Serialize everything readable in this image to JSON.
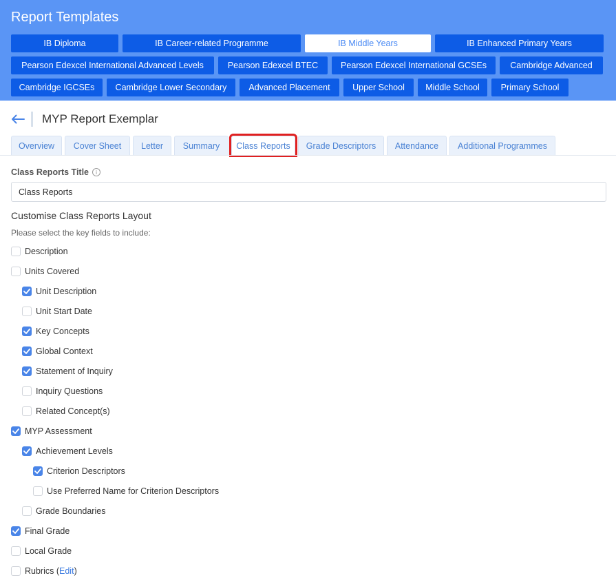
{
  "header": {
    "title": "Report Templates",
    "rows": [
      [
        {
          "label": "IB Diploma",
          "active": false
        },
        {
          "label": "IB Career-related Programme",
          "active": false
        },
        {
          "label": "IB Middle Years",
          "active": true
        },
        {
          "label": "IB Enhanced Primary Years",
          "active": false
        }
      ],
      [
        {
          "label": "Pearson Edexcel International Advanced Levels",
          "active": false
        },
        {
          "label": "Pearson Edexcel BTEC",
          "active": false
        },
        {
          "label": "Pearson Edexcel International GCSEs",
          "active": false
        },
        {
          "label": "Cambridge Advanced",
          "active": false
        }
      ],
      [
        {
          "label": "Cambridge IGCSEs",
          "active": false
        },
        {
          "label": "Cambridge Lower Secondary",
          "active": false
        },
        {
          "label": "Advanced Placement",
          "active": false
        },
        {
          "label": "Upper School",
          "active": false
        },
        {
          "label": "Middle School",
          "active": false
        },
        {
          "label": "Primary School",
          "active": false
        }
      ]
    ]
  },
  "page": {
    "title": "MYP Report Exemplar",
    "back_icon": "arrow-left-icon"
  },
  "tabs": [
    {
      "label": "Overview",
      "active": false
    },
    {
      "label": "Cover Sheet",
      "active": false
    },
    {
      "label": "Letter",
      "active": false
    },
    {
      "label": "Summary",
      "active": false
    },
    {
      "label": "Class Reports",
      "active": true
    },
    {
      "label": "Grade Descriptors",
      "active": false
    },
    {
      "label": "Attendance",
      "active": false
    },
    {
      "label": "Additional Programmes",
      "active": false
    }
  ],
  "form": {
    "title_label": "Class Reports Title",
    "info_icon": "info-icon",
    "title_value": "Class Reports",
    "layout_heading": "Customise Class Reports Layout",
    "layout_sub": "Please select the key fields to include:"
  },
  "fields": [
    {
      "label": "Description",
      "checked": false,
      "level": 0
    },
    {
      "label": "Units Covered",
      "checked": false,
      "level": 0
    },
    {
      "label": "Unit Description",
      "checked": true,
      "level": 1
    },
    {
      "label": "Unit Start Date",
      "checked": false,
      "level": 1
    },
    {
      "label": "Key Concepts",
      "checked": true,
      "level": 1
    },
    {
      "label": "Global Context",
      "checked": true,
      "level": 1
    },
    {
      "label": "Statement of Inquiry",
      "checked": true,
      "level": 1
    },
    {
      "label": "Inquiry Questions",
      "checked": false,
      "level": 1
    },
    {
      "label": "Related Concept(s)",
      "checked": false,
      "level": 1
    },
    {
      "label": "MYP Assessment",
      "checked": true,
      "level": 0
    },
    {
      "label": "Achievement Levels",
      "checked": true,
      "level": 1
    },
    {
      "label": "Criterion Descriptors",
      "checked": true,
      "level": 2
    },
    {
      "label": "Use Preferred Name for Criterion Descriptors",
      "checked": false,
      "level": 2
    },
    {
      "label": "Grade Boundaries",
      "checked": false,
      "level": 1
    },
    {
      "label": "Final Grade",
      "checked": true,
      "level": 0
    },
    {
      "label": "Local Grade",
      "checked": false,
      "level": 0
    },
    {
      "label": "Rubrics",
      "checked": false,
      "level": 0,
      "link": "Edit"
    }
  ],
  "colors": {
    "header_bg": "#5a95f5",
    "button_bg": "#0d5ce6",
    "accent": "#4a85e8",
    "highlight": "#e02020"
  }
}
